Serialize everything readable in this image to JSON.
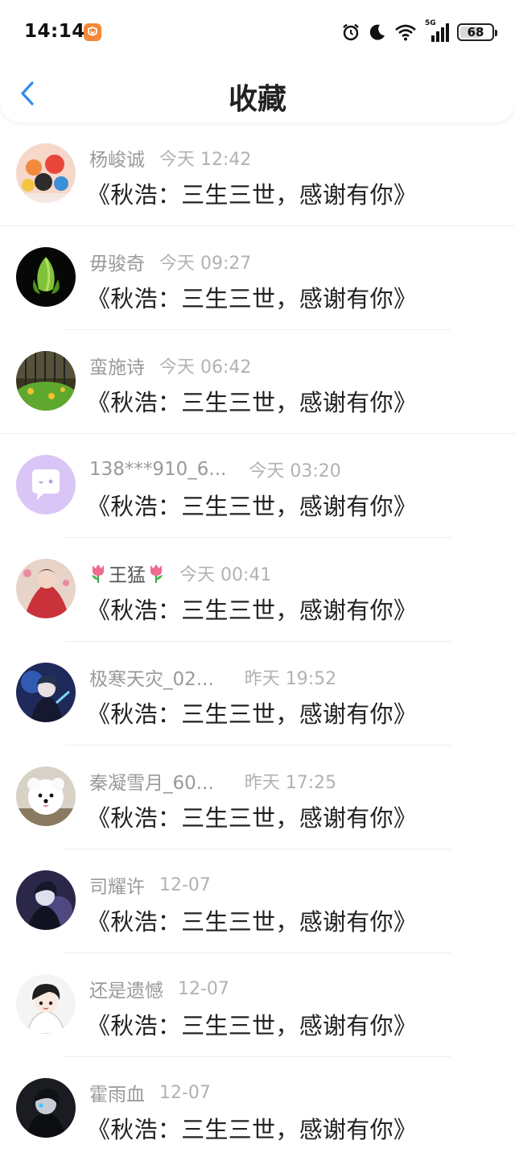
{
  "status_bar": {
    "time": "14:14",
    "network": "5G",
    "battery": "68",
    "battery_level": 0.68,
    "icons": [
      "app-badge-icon",
      "alarm-icon",
      "moon-icon",
      "wifi-icon",
      "signal-icon",
      "battery-icon"
    ]
  },
  "header": {
    "title": "收藏",
    "back_icon": "chevron-left-icon"
  },
  "colors": {
    "accent": "#2f8cf0",
    "username": "#9a9a9a",
    "time": "#b2b2b2",
    "title": "#222222"
  },
  "items": [
    {
      "username": "杨峻诚",
      "time": "今天 12:42",
      "title": "《秋浩：三生三世，感谢有你》"
    },
    {
      "username": "毋骏奇",
      "time": "今天 09:27",
      "title": "《秋浩：三生三世，感谢有你》"
    },
    {
      "username": "蛮施诗",
      "time": "今天 06:42",
      "title": "《秋浩：三生三世，感谢有你》"
    },
    {
      "username": "138***910_6...",
      "time": "今天 03:20",
      "title": "《秋浩：三生三世，感谢有你》"
    },
    {
      "username": "王猛",
      "time": "今天 00:41",
      "title": "《秋浩：三生三世，感谢有你》"
    },
    {
      "username": "极寒天灾_02...",
      "time": "昨天 19:52",
      "title": "《秋浩：三生三世，感谢有你》"
    },
    {
      "username": "秦凝雪月_60...",
      "time": "昨天 17:25",
      "title": "《秋浩：三生三世，感谢有你》"
    },
    {
      "username": "司耀许",
      "time": "12-07",
      "title": "《秋浩：三生三世，感谢有你》"
    },
    {
      "username": "还是遗憾",
      "time": "12-07",
      "title": "《秋浩：三生三世，感谢有你》"
    },
    {
      "username": "霍雨血",
      "time": "12-07",
      "title": "《秋浩：三生三世，感谢有你》"
    }
  ]
}
